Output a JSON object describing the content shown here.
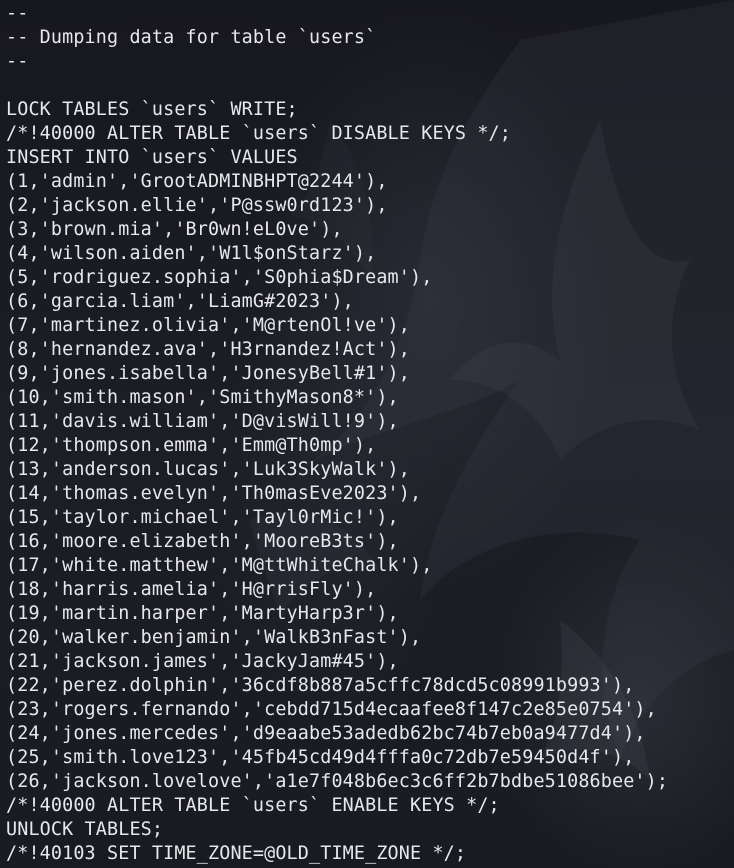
{
  "terminal": {
    "lines": [
      "--",
      "-- Dumping data for table `users`",
      "--",
      "",
      "LOCK TABLES `users` WRITE;",
      "/*!40000 ALTER TABLE `users` DISABLE KEYS */;",
      "INSERT INTO `users` VALUES",
      "(1,'admin','GrootADMINBHPT@2244'),",
      "(2,'jackson.ellie','P@ssw0rd123'),",
      "(3,'brown.mia','Br0wn!eL0ve'),",
      "(4,'wilson.aiden','W1l$onStarz'),",
      "(5,'rodriguez.sophia','S0phia$Dream'),",
      "(6,'garcia.liam','LiamG#2023'),",
      "(7,'martinez.olivia','M@rtenOl!ve'),",
      "(8,'hernandez.ava','H3rnandez!Act'),",
      "(9,'jones.isabella','JonesyBell#1'),",
      "(10,'smith.mason','SmithyMason8*'),",
      "(11,'davis.william','D@visWill!9'),",
      "(12,'thompson.emma','Emm@Th0mp'),",
      "(13,'anderson.lucas','Luk3SkyWalk'),",
      "(14,'thomas.evelyn','Th0masEve2023'),",
      "(15,'taylor.michael','Tayl0rMic!'),",
      "(16,'moore.elizabeth','MooreB3ts'),",
      "(17,'white.matthew','M@ttWhiteChalk'),",
      "(18,'harris.amelia','H@rrisFly'),",
      "(19,'martin.harper','MartyHarp3r'),",
      "(20,'walker.benjamin','WalkB3nFast'),",
      "(21,'jackson.james','JackyJam#45'),",
      "(22,'perez.dolphin','36cdf8b887a5cffc78dcd5c08991b993'),",
      "(23,'rogers.fernando','cebdd715d4ecaafee8f147c2e85e0754'),",
      "(24,'jones.mercedes','d9eaabe53adedb62bc74b7eb0a9477d4'),",
      "(25,'smith.love123','45fb45cd49d4fffa0c72db7e59450d4f'),",
      "(26,'jackson.lovelove','a1e7f048b6ec3c6ff2b7bdbe51086bee');",
      "/*!40000 ALTER TABLE `users` ENABLE KEYS */;",
      "UNLOCK TABLES;",
      "/*!40103 SET TIME_ZONE=@OLD_TIME_ZONE */;"
    ]
  },
  "colors": {
    "background": "#14151a",
    "text": "#e7e8ec"
  }
}
